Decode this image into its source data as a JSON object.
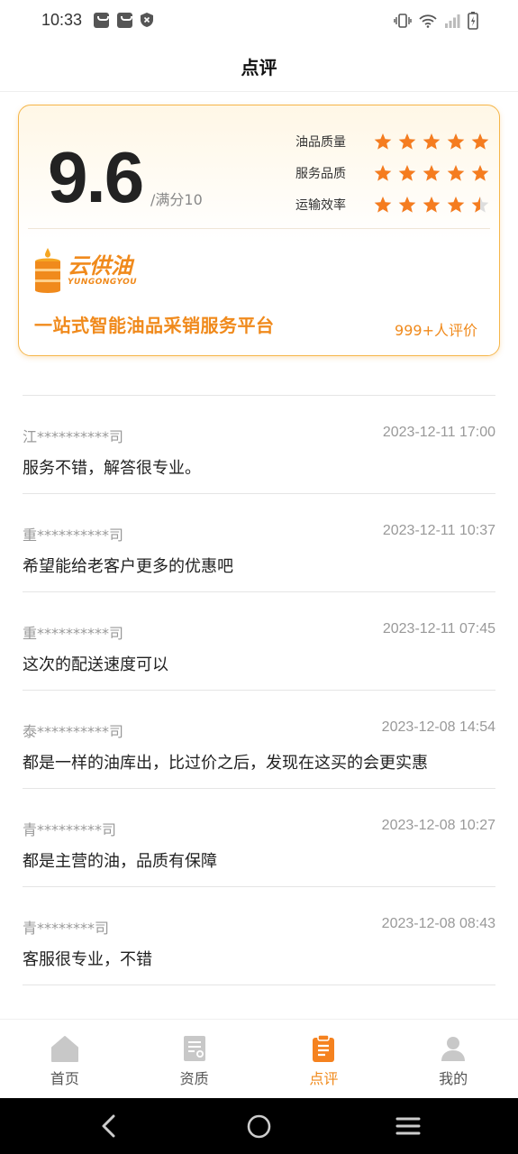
{
  "status_bar": {
    "time": "10:33"
  },
  "header": {
    "title": "点评"
  },
  "score": {
    "value": "9.6",
    "max_label": "/满分10",
    "ratings": [
      {
        "label": "油品质量",
        "stars": 5
      },
      {
        "label": "服务品质",
        "stars": 5
      },
      {
        "label": "运输效率",
        "stars": 4.5
      }
    ],
    "brand_cn": "云供油",
    "brand_en": "YUNGONGYOU",
    "slogan": "一站式智能油品采销服务平台",
    "review_count": "999+人评价",
    "accent": "#f08a1c",
    "star_color": "#f57c1f"
  },
  "reviews": [
    {
      "user": "江**********司",
      "date": "2023-12-11 17:00",
      "text": "服务不错，解答很专业。"
    },
    {
      "user": "重**********司",
      "date": "2023-12-11 10:37",
      "text": "希望能给老客户更多的优惠吧"
    },
    {
      "user": "重**********司",
      "date": "2023-12-11 07:45",
      "text": "这次的配送速度可以"
    },
    {
      "user": "泰**********司",
      "date": "2023-12-08 14:54",
      "text": "都是一样的油库出，比过价之后，发现在这买的会更实惠"
    },
    {
      "user": "青*********司",
      "date": "2023-12-08 10:27",
      "text": "都是主营的油，品质有保障"
    },
    {
      "user": "青********司",
      "date": "2023-12-08 08:43",
      "text": "客服很专业，不错"
    }
  ],
  "tabs": [
    {
      "label": "首页",
      "icon": "home-icon",
      "active": false
    },
    {
      "label": "资质",
      "icon": "certificate-icon",
      "active": false
    },
    {
      "label": "点评",
      "icon": "clipboard-icon",
      "active": true
    },
    {
      "label": "我的",
      "icon": "person-icon",
      "active": false
    }
  ]
}
